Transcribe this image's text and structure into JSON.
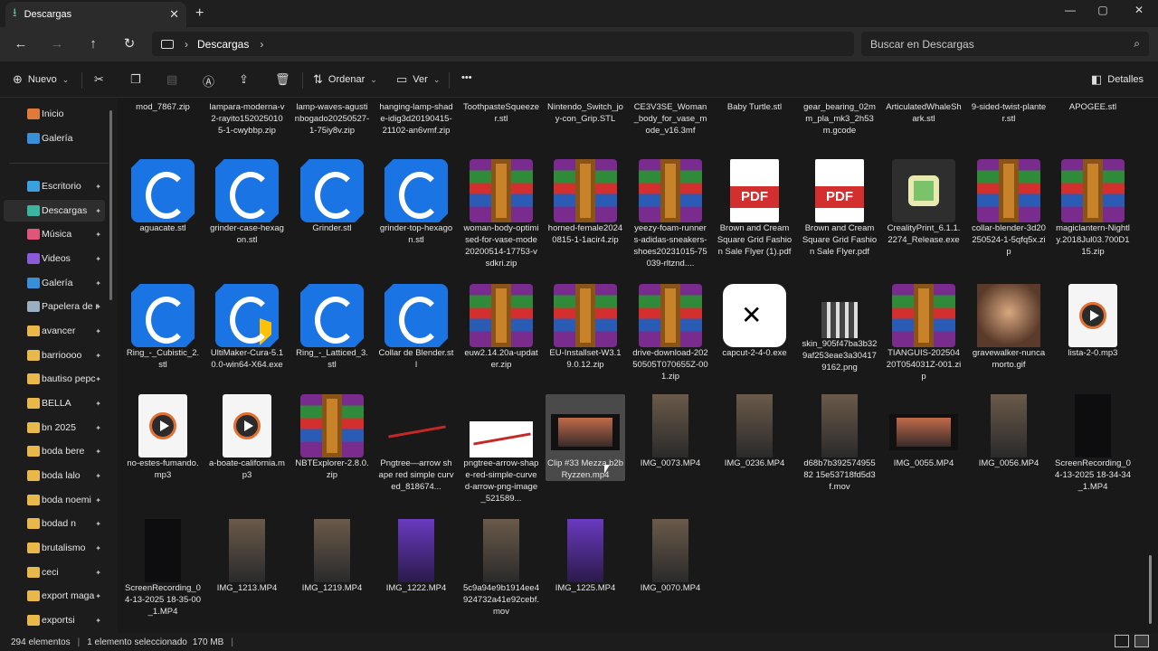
{
  "window": {
    "tab_title": "Descargas",
    "tab_close": "✕",
    "new_tab": "+",
    "controls": {
      "minimize": "—",
      "maximize": "▢",
      "close": "✕"
    }
  },
  "nav": {
    "back": "←",
    "forward": "→",
    "up": "↑",
    "refresh": "↻",
    "breadcrumb_sep": "›",
    "breadcrumb": [
      "Descargas"
    ],
    "breadcrumb_end": "›",
    "search_placeholder": "Buscar en Descargas",
    "search_icon": "⌕"
  },
  "toolbar": {
    "new_label": "Nuevo",
    "sort_label": "Ordenar",
    "view_label": "Ver",
    "more": "•••",
    "details_label": "Detalles",
    "icons": [
      "cut-icon",
      "copy-icon",
      "paste-icon",
      "rename-icon",
      "share-icon",
      "delete-icon"
    ]
  },
  "sidebar": {
    "items": [
      {
        "label": "Inicio",
        "icon": "home-icon",
        "color": "#e07a3a",
        "pinned": false
      },
      {
        "label": "Galería",
        "icon": "gallery-icon",
        "color": "#3a8fd9",
        "pinned": false
      },
      {
        "label": "Escritorio",
        "icon": "desktop-icon",
        "color": "#3aa0e0",
        "pinned": true
      },
      {
        "label": "Descargas",
        "icon": "download-icon",
        "color": "#3ab5a0",
        "pinned": true
      },
      {
        "label": "Música",
        "icon": "music-icon",
        "color": "#e0557a",
        "pinned": true
      },
      {
        "label": "Videos",
        "icon": "video-icon",
        "color": "#8a5ad9",
        "pinned": true
      },
      {
        "label": "Galería",
        "icon": "gallery-icon",
        "color": "#3a8fd9",
        "pinned": true
      },
      {
        "label": "Papelera de r",
        "icon": "recycle-bin-icon",
        "color": "#9ab0c0",
        "pinned": true
      },
      {
        "label": "avancer",
        "icon": "folder-icon",
        "color": "#e8b84a",
        "pinned": true
      },
      {
        "label": "barrioooo",
        "icon": "folder-icon",
        "color": "#e8b84a",
        "pinned": true
      },
      {
        "label": "bautiso pepc",
        "icon": "folder-icon",
        "color": "#e8b84a",
        "pinned": true
      },
      {
        "label": "BELLA",
        "icon": "folder-icon",
        "color": "#e8b84a",
        "pinned": true
      },
      {
        "label": "bn 2025",
        "icon": "folder-icon",
        "color": "#e8b84a",
        "pinned": true
      },
      {
        "label": "boda bere",
        "icon": "folder-icon",
        "color": "#e8b84a",
        "pinned": true
      },
      {
        "label": "boda lalo",
        "icon": "folder-icon",
        "color": "#e8b84a",
        "pinned": true
      },
      {
        "label": "boda noemi",
        "icon": "folder-icon",
        "color": "#e8b84a",
        "pinned": true
      },
      {
        "label": "bodad n",
        "icon": "folder-icon",
        "color": "#e8b84a",
        "pinned": true
      },
      {
        "label": "brutalismo",
        "icon": "folder-icon",
        "color": "#e8b84a",
        "pinned": true
      },
      {
        "label": "ceci",
        "icon": "folder-icon",
        "color": "#e8b84a",
        "pinned": true
      },
      {
        "label": "export maga",
        "icon": "folder-icon",
        "color": "#e8b84a",
        "pinned": true
      },
      {
        "label": "exportsi",
        "icon": "folder-icon",
        "color": "#e8b84a",
        "pinned": true
      }
    ],
    "pin_glyph": "📌"
  },
  "files": {
    "row0": [
      "mod_7867.zip",
      "lampara-moderna-v2-rayito1520250105-1-cwybbp.zip",
      "lamp-waves-agustinbogado20250527-1-75iy8v.zip",
      "hanging-lamp-shade-idig3d20190415-21102-an6vmf.zip",
      "ToothpasteSqueezer.stl",
      "Nintendo_Switch_joy-con_Grip.STL",
      "CE3V3SE_Woman_body_for_vase_mode_v16.3mf",
      "Baby Turtle.stl",
      "gear_bearing_02mm_pla_mk3_2h53m.gcode",
      "ArticulatedWhaleShark.stl",
      "9-sided-twist-planter.stl",
      "APOGEE.stl"
    ],
    "row1": [
      {
        "name": "aguacate.stl",
        "kind": "cura"
      },
      {
        "name": "grinder-case-hexagon.stl",
        "kind": "cura"
      },
      {
        "name": "Grinder.stl",
        "kind": "cura"
      },
      {
        "name": "grinder-top-hexagon.stl",
        "kind": "cura"
      },
      {
        "name": "woman-body-optimised-for-vase-mode20200514-17753-vsdkri.zip",
        "kind": "winrar"
      },
      {
        "name": "horned-female20240815-1-1acir4.zip",
        "kind": "winrar"
      },
      {
        "name": "yeezy-foam-runners-adidas-sneakers-shoes20231015-75039-rltznd....",
        "kind": "winrar"
      },
      {
        "name": "Brown and Cream Square Grid Fashion Sale Flyer (1).pdf",
        "kind": "pdf"
      },
      {
        "name": "Brown and Cream Square Grid Fashion Sale Flyer.pdf",
        "kind": "pdf"
      },
      {
        "name": "CrealityPrint_6.1.1.2274_Release.exe",
        "kind": "exe"
      },
      {
        "name": "collar-blender-3d20250524-1-5qfq5x.zip",
        "kind": "winrar"
      },
      {
        "name": "magiclantern-Nightly.2018Jul03.700D115.zip",
        "kind": "winrar"
      }
    ],
    "row2": [
      {
        "name": "Ring_-_Cubistic_2.stl",
        "kind": "cura"
      },
      {
        "name": "UltiMaker-Cura-5.10.0-win64-X64.exe",
        "kind": "cura-installer"
      },
      {
        "name": "Ring_-_Latticed_3.stl",
        "kind": "cura"
      },
      {
        "name": "Collar de Blender.stl",
        "kind": "cura"
      },
      {
        "name": "euw2.14.20a-updater.zip",
        "kind": "winrar"
      },
      {
        "name": "EU-Installset-W3.19.0.12.zip",
        "kind": "winrar"
      },
      {
        "name": "drive-download-20250505T070655Z-001.zip",
        "kind": "winrar"
      },
      {
        "name": "capcut-2-4-0.exe",
        "kind": "capcut"
      },
      {
        "name": "skin_905f47ba3b329af253eae3a304179162.png",
        "kind": "png"
      },
      {
        "name": "TIANGUIS-20250420T054031Z-001.zip",
        "kind": "winrar"
      },
      {
        "name": "gravewalker-nuncamorto.gif",
        "kind": "gif"
      },
      {
        "name": "lista-2-0.mp3",
        "kind": "mp3"
      }
    ],
    "row3": [
      {
        "name": "no-estes-fumando.mp3",
        "kind": "mp3"
      },
      {
        "name": "a-boate-california.mp3",
        "kind": "mp3"
      },
      {
        "name": "NBTExplorer-2.8.0.zip",
        "kind": "winrar"
      },
      {
        "name": "Pngtree—arrow shape red simple curved_818674...",
        "kind": "arrow"
      },
      {
        "name": "pngtree-arrow-shape-red-simple-curved-arrow-png-image_521589...",
        "kind": "arrow-bg"
      },
      {
        "name": "Clip #33 Mezza b2b Ryzzen.mp4",
        "kind": "video-film"
      },
      {
        "name": "IMG_0073.MP4",
        "kind": "video"
      },
      {
        "name": "IMG_0236.MP4",
        "kind": "video"
      },
      {
        "name": "d68b7b39257495582 15e53718fd5d3f.mov",
        "kind": "video"
      },
      {
        "name": "IMG_0055.MP4",
        "kind": "video-film"
      },
      {
        "name": "IMG_0056.MP4",
        "kind": "video"
      },
      {
        "name": "ScreenRecording_04-13-2025 18-34-34_1.MP4",
        "kind": "video-dark"
      }
    ],
    "row4": [
      {
        "name": "ScreenRecording_04-13-2025 18-35-00_1.MP4",
        "kind": "video-dark"
      },
      {
        "name": "IMG_1213.MP4",
        "kind": "video"
      },
      {
        "name": "IMG_1219.MP4",
        "kind": "video"
      },
      {
        "name": "IMG_1222.MP4",
        "kind": "video-purple"
      },
      {
        "name": "5c9a94e9b1914ee4924732a41e92cebf.mov",
        "kind": "video"
      },
      {
        "name": "IMG_1225.MP4",
        "kind": "video-purple"
      },
      {
        "name": "IMG_0070.MP4",
        "kind": "video"
      }
    ],
    "pdf_badge": "PDF",
    "capcut_glyph": "✕"
  },
  "status": {
    "count": "294 elementos",
    "selected": "1 elemento seleccionado",
    "size": "170 MB"
  }
}
